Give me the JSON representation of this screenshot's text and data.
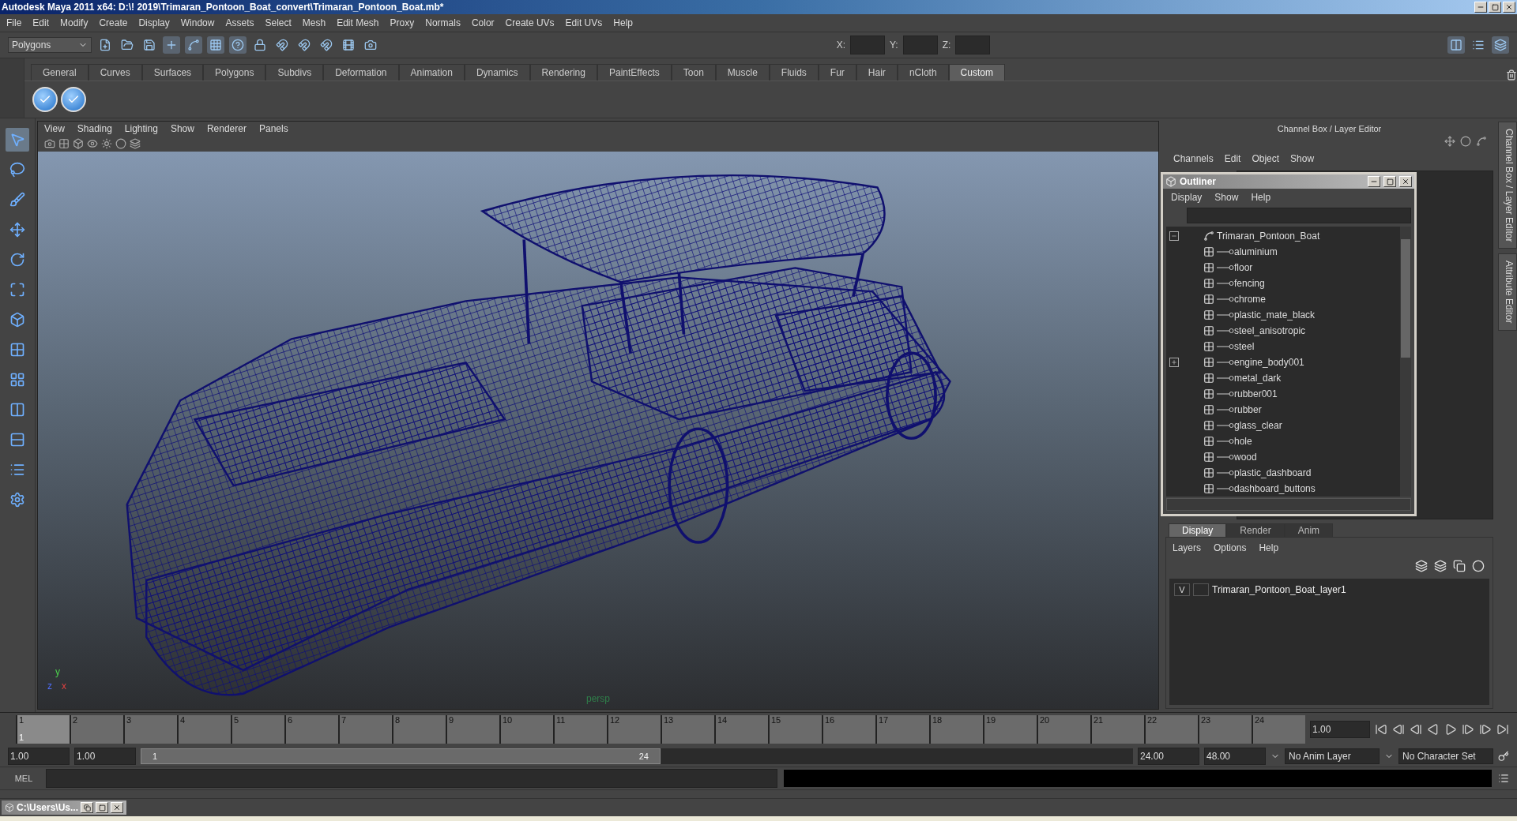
{
  "window": {
    "title": "Autodesk Maya 2011 x64: D:\\! 2019\\Trimaran_Pontoon_Boat_convert\\Trimaran_Pontoon_Boat.mb*"
  },
  "menu_bar": [
    "File",
    "Edit",
    "Modify",
    "Create",
    "Display",
    "Window",
    "Assets",
    "Select",
    "Mesh",
    "Edit Mesh",
    "Proxy",
    "Normals",
    "Color",
    "Create UVs",
    "Edit UVs",
    "Help"
  ],
  "status_line": {
    "mode": "Polygons",
    "coords": [
      "X:",
      "Y:",
      "Z:"
    ]
  },
  "shelf": {
    "tabs": [
      {
        "label": "General",
        "selected": false
      },
      {
        "label": "Curves",
        "selected": false
      },
      {
        "label": "Surfaces",
        "selected": false
      },
      {
        "label": "Polygons",
        "selected": false
      },
      {
        "label": "Subdivs",
        "selected": false
      },
      {
        "label": "Deformation",
        "selected": false
      },
      {
        "label": "Animation",
        "selected": false
      },
      {
        "label": "Dynamics",
        "selected": false
      },
      {
        "label": "Rendering",
        "selected": false
      },
      {
        "label": "PaintEffects",
        "selected": false
      },
      {
        "label": "Toon",
        "selected": false
      },
      {
        "label": "Muscle",
        "selected": false
      },
      {
        "label": "Fluids",
        "selected": false
      },
      {
        "label": "Fur",
        "selected": false
      },
      {
        "label": "Hair",
        "selected": false
      },
      {
        "label": "nCloth",
        "selected": false
      },
      {
        "label": "Custom",
        "selected": true
      }
    ]
  },
  "viewport": {
    "menu": [
      "View",
      "Shading",
      "Lighting",
      "Show",
      "Renderer",
      "Panels"
    ],
    "axis_labels": [
      "y",
      "z",
      "x"
    ],
    "camera_label": "persp"
  },
  "channel_box": {
    "title": "Channel Box / Layer Editor",
    "menu": [
      "Channels",
      "Edit",
      "Object",
      "Show"
    ]
  },
  "outliner": {
    "title": "Outliner",
    "menu": [
      "Display",
      "Show",
      "Help"
    ],
    "tree": {
      "label": "Trimaran_Pontoon_Boat",
      "expanded": true,
      "children": [
        {
          "label": "aluminium",
          "expandable": false
        },
        {
          "label": "floor",
          "expandable": false
        },
        {
          "label": "fencing",
          "expandable": false
        },
        {
          "label": "chrome",
          "expandable": false
        },
        {
          "label": "plastic_mate_black",
          "expandable": false
        },
        {
          "label": "steel_anisotropic",
          "expandable": false
        },
        {
          "label": "steel",
          "expandable": false
        },
        {
          "label": "engine_body001",
          "expandable": true
        },
        {
          "label": "metal_dark",
          "expandable": false
        },
        {
          "label": "rubber001",
          "expandable": false
        },
        {
          "label": "rubber",
          "expandable": false
        },
        {
          "label": "glass_clear",
          "expandable": false
        },
        {
          "label": "hole",
          "expandable": false
        },
        {
          "label": "wood",
          "expandable": false
        },
        {
          "label": "plastic_dashboard",
          "expandable": false
        },
        {
          "label": "dashboard_buttons",
          "expandable": false
        }
      ]
    }
  },
  "layer_editor": {
    "tabs": [
      {
        "label": "Display",
        "selected": true
      },
      {
        "label": "Render",
        "selected": false
      },
      {
        "label": "Anim",
        "selected": false
      }
    ],
    "menu": [
      "Layers",
      "Options",
      "Help"
    ],
    "layers": [
      {
        "visibility": "V",
        "name": "Trimaran_Pontoon_Boat_layer1"
      }
    ]
  },
  "side_tabs": [
    "Channel Box / Layer Editor",
    "Attribute Editor"
  ],
  "timeline": {
    "ticks": [
      "1",
      "2",
      "3",
      "4",
      "5",
      "6",
      "7",
      "8",
      "9",
      "10",
      "11",
      "12",
      "13",
      "14",
      "15",
      "16",
      "17",
      "18",
      "19",
      "20",
      "21",
      "22",
      "23",
      "24"
    ],
    "current_frame": "1",
    "current_time": "1.00",
    "level": 0.042
  },
  "range": {
    "start": "1.00",
    "play_start": "1.00",
    "slider_start": "1",
    "slider_end": "24",
    "level": 0.5,
    "play_end": "24.00",
    "end": "48.00",
    "anim_layer": "No Anim Layer",
    "character_set": "No Character Set"
  },
  "command_line": {
    "label": "MEL"
  },
  "taskbar": {
    "window": "C:\\Users\\Us..."
  }
}
